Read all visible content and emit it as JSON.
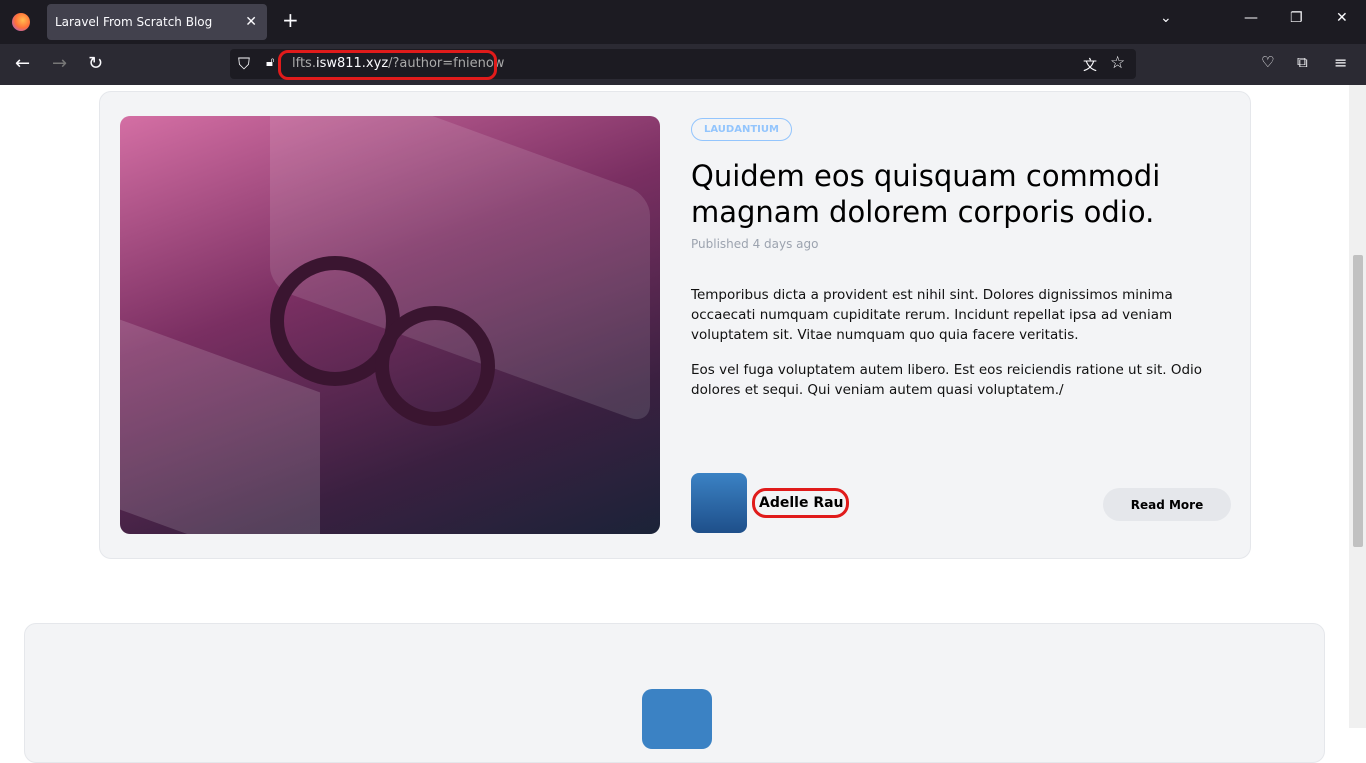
{
  "browser": {
    "tab_title": "Laravel From Scratch Blog",
    "url_host_prefix": "lfts.",
    "url_domain": "isw811.xyz",
    "url_path": "/?author=fnienow"
  },
  "post": {
    "category": "LAUDANTIUM",
    "title": "Quidem eos quisquam commodi magnam dolorem corporis odio.",
    "published": "Published 4 days ago",
    "paragraphs": [
      "Temporibus dicta a provident est nihil sint. Dolores dignissimos minima occaecati numquam cupiditate rerum. Incidunt repellat ipsa ad veniam voluptatem sit. Vitae numquam quo quia facere veritatis.",
      "Eos vel fuga voluptatem autem libero. Est eos reiciendis ratione ut sit. Odio dolores et sequi. Qui veniam autem quasi voluptatem./"
    ],
    "author": "Adelle Rau",
    "read_more": "Read More"
  },
  "annotation_color": "#e01b1b"
}
